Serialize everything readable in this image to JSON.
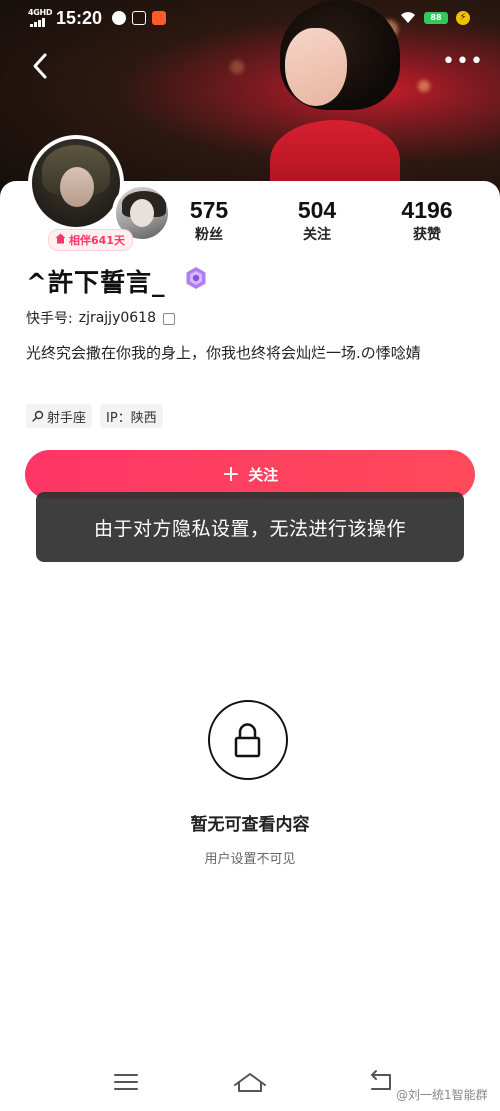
{
  "status_bar": {
    "network": "4GHD",
    "time": "15:20",
    "battery": "88"
  },
  "profile": {
    "companion_badge": "相伴641天",
    "stats": [
      {
        "value": "575",
        "label": "粉丝"
      },
      {
        "value": "504",
        "label": "关注"
      },
      {
        "value": "4196",
        "label": "获赞"
      }
    ],
    "nickname": "^許下誓言_",
    "kwai_id_label": "快手号:",
    "kwai_id": "zjrajjy0618",
    "bio": "光终究会撒在你我的身上，你我也终将会灿烂一场.の悸唸婧",
    "tags": [
      {
        "icon": "search-icon",
        "label": "射手座"
      },
      {
        "label": "IP：陕西"
      }
    ]
  },
  "follow_button": {
    "label": "关注"
  },
  "toast": "由于对方隐私设置，无法进行该操作",
  "empty_state": {
    "icon": "lock-icon",
    "title": "暂无可查看内容",
    "subtitle": "用户设置不可见"
  },
  "watermark": "@刘一统1智能群",
  "colors": {
    "accent": "#fe3666",
    "toast_bg": "#323232",
    "battery": "#34c759"
  }
}
